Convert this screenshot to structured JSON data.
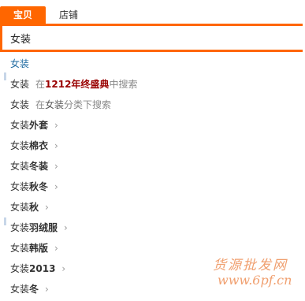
{
  "tabs": [
    {
      "label": "宝贝",
      "active": true
    },
    {
      "label": "店铺",
      "active": false
    }
  ],
  "search": {
    "value": "女装"
  },
  "suggestions": {
    "first": {
      "text": "女装"
    },
    "event": {
      "keyword": "女装",
      "prefix": "在",
      "event_name": "1212年终盛典",
      "suffix": "中搜索"
    },
    "category": {
      "keyword": "女装",
      "prefix": "在",
      "category": "女装",
      "suffix": "分类下搜索"
    },
    "items": [
      {
        "base": "女装",
        "suffix": "外套"
      },
      {
        "base": "女装",
        "suffix": "棉衣"
      },
      {
        "base": "女装",
        "suffix": "冬装"
      },
      {
        "base": "女装",
        "suffix": "秋冬"
      },
      {
        "base": "女装",
        "suffix": "秋"
      },
      {
        "base": "女装",
        "suffix": "羽绒服"
      },
      {
        "base": "女装",
        "suffix": "韩版"
      },
      {
        "base": "女装",
        "suffix": "2013"
      },
      {
        "base": "女装",
        "suffix": "冬"
      }
    ]
  },
  "chevron_glyph": "›",
  "watermark": {
    "line1": "货源批发网",
    "line2": "www.6pf.cn"
  },
  "colors": {
    "accent": "#ff6600",
    "event": "#990000",
    "link": "#1e6aa0",
    "hint": "#888888"
  }
}
